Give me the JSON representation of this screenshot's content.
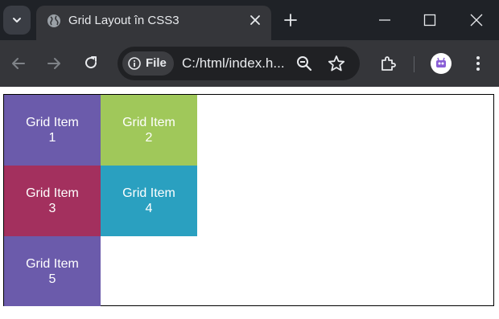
{
  "browser": {
    "tab": {
      "title": "Grid Layout în CSS3"
    },
    "address_bar": {
      "chip_label": "File",
      "url": "C:/html/index.h..."
    },
    "icons": [
      "tab-search-icon",
      "globe-icon",
      "close-icon",
      "plus-icon",
      "minimize-icon",
      "maximize-icon",
      "window-close-icon",
      "back-arrow-icon",
      "forward-arrow-icon",
      "reload-icon",
      "info-icon",
      "zoom-out-icon",
      "star-icon",
      "extensions-icon",
      "profile-avatar",
      "more-menu-icon"
    ]
  },
  "page": {
    "grid_items": [
      {
        "line1": "Grid Item",
        "line2": "1",
        "color": "#6b5bab"
      },
      {
        "line1": "Grid Item",
        "line2": "2",
        "color": "#a0c85a"
      },
      {
        "line1": "Grid Item",
        "line2": "3",
        "color": "#a3305e"
      },
      {
        "line1": "Grid Item",
        "line2": "4",
        "color": "#2aa0c0"
      },
      {
        "line1": "Grid Item",
        "line2": "5",
        "color": "#6b5bab"
      }
    ]
  },
  "colors": {
    "tabstrip": "#1f2227",
    "toolbar": "#35363a",
    "omnibox": "#202124",
    "text": "#e8eaed"
  }
}
